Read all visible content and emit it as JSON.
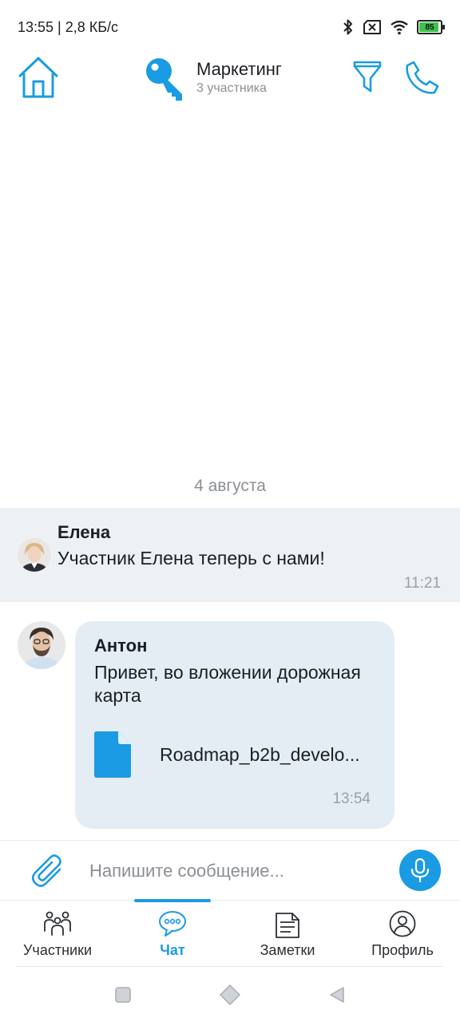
{
  "status_bar": {
    "time_speed": "13:55 | 2,8 КБ/с",
    "battery_level": "85",
    "battery_fraction": 0.85,
    "icons": [
      "bluetooth-icon",
      "sim-off-icon",
      "wifi-icon",
      "battery-icon"
    ]
  },
  "header": {
    "title": "Маркетинг",
    "subtitle": "3 участника",
    "icons": [
      "home-icon",
      "key-icon",
      "filter-icon",
      "phone-icon"
    ]
  },
  "chat": {
    "date_separator": "4 августа",
    "system_message": {
      "author": "Елена",
      "text": "Участник Елена теперь с нами!",
      "time": "11:21"
    },
    "message": {
      "author": "Антон",
      "text": "Привет, во вложении дорожная карта",
      "attachment": "Roadmap_b2b_develo...",
      "time": "13:54"
    }
  },
  "composer": {
    "placeholder": "Напишите сообщение..."
  },
  "tabs": [
    {
      "label": "Участники",
      "icon": "people-icon"
    },
    {
      "label": "Чат",
      "icon": "chat-icon",
      "active": true
    },
    {
      "label": "Заметки",
      "icon": "notes-icon"
    },
    {
      "label": "Профиль",
      "icon": "profile-icon"
    }
  ],
  "colors": {
    "accent": "#1a9be3",
    "system_bg": "#eef1f4",
    "bubble_bg": "#e4ecf4"
  }
}
